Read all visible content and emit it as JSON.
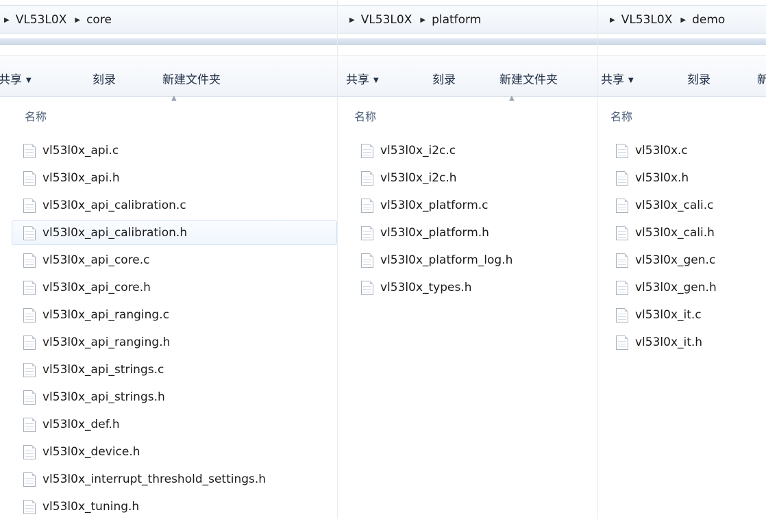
{
  "panes": [
    {
      "crumbs": [
        "VL53L0X",
        "core"
      ],
      "toolbar": {
        "share": "共享",
        "burn": "刻录",
        "new_folder": "新建文件夹"
      },
      "column_header": "名称",
      "files": [
        "vl53l0x_api.c",
        "vl53l0x_api.h",
        "vl53l0x_api_calibration.c",
        "vl53l0x_api_calibration.h",
        "vl53l0x_api_core.c",
        "vl53l0x_api_core.h",
        "vl53l0x_api_ranging.c",
        "vl53l0x_api_ranging.h",
        "vl53l0x_api_strings.c",
        "vl53l0x_api_strings.h",
        "vl53l0x_def.h",
        "vl53l0x_device.h",
        "vl53l0x_interrupt_threshold_settings.h",
        "vl53l0x_tuning.h"
      ],
      "hovered_file": "vl53l0x_api_calibration.h"
    },
    {
      "crumbs": [
        "VL53L0X",
        "platform"
      ],
      "toolbar": {
        "share": "共享",
        "burn": "刻录",
        "new_folder": "新建文件夹"
      },
      "column_header": "名称",
      "files": [
        "vl53l0x_i2c.c",
        "vl53l0x_i2c.h",
        "vl53l0x_platform.c",
        "vl53l0x_platform.h",
        "vl53l0x_platform_log.h",
        "vl53l0x_types.h"
      ]
    },
    {
      "crumbs": [
        "VL53L0X",
        "demo"
      ],
      "toolbar": {
        "share": "共享",
        "burn": "刻录",
        "new_folder_partial": "新"
      },
      "column_header": "名称",
      "files": [
        "vl53l0x.c",
        "vl53l0x.h",
        "vl53l0x_cali.c",
        "vl53l0x_cali.h",
        "vl53l0x_gen.c",
        "vl53l0x_gen.h",
        "vl53l0x_it.c",
        "vl53l0x_it.h"
      ]
    }
  ],
  "icons": {
    "breadcrumb_separator": "triangle-right-icon",
    "dropdown": "caret-down-icon",
    "sort": "sort-up-icon",
    "file": "text-file-icon"
  }
}
